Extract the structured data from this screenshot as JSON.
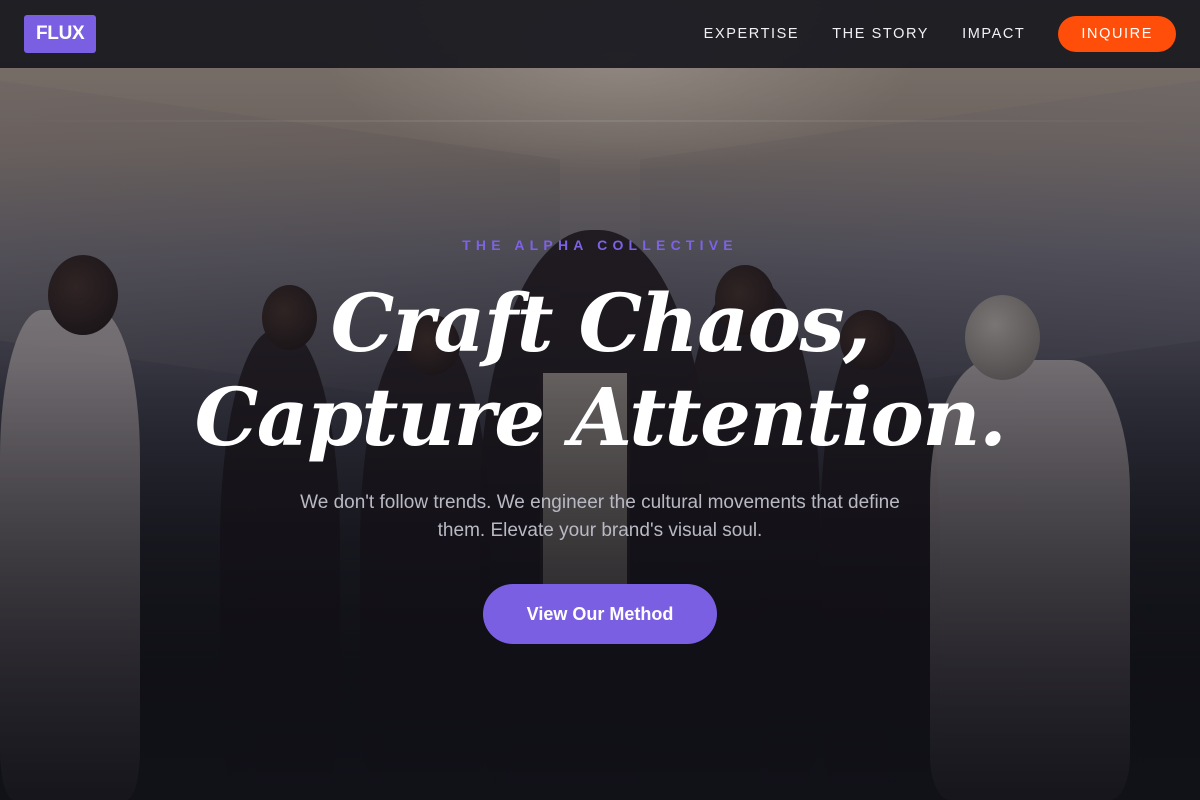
{
  "nav": {
    "logo": "FLUX",
    "links": [
      "EXPERTISE",
      "THE STORY",
      "IMPACT"
    ],
    "cta": "INQUIRE"
  },
  "hero": {
    "eyebrow": "THE ALPHA COLLECTIVE",
    "headline_line1": "Craft Chaos,",
    "headline_line2": "Capture Attention.",
    "subtext": "We don't follow trends. We engineer the cultural movements that define them. Elevate your brand's visual soul.",
    "cta": "View Our Method"
  },
  "colors": {
    "accent": "#7b5fe3",
    "cta_orange": "#ff4d0a",
    "nav_bg": "#18181e",
    "text": "#ffffff"
  }
}
